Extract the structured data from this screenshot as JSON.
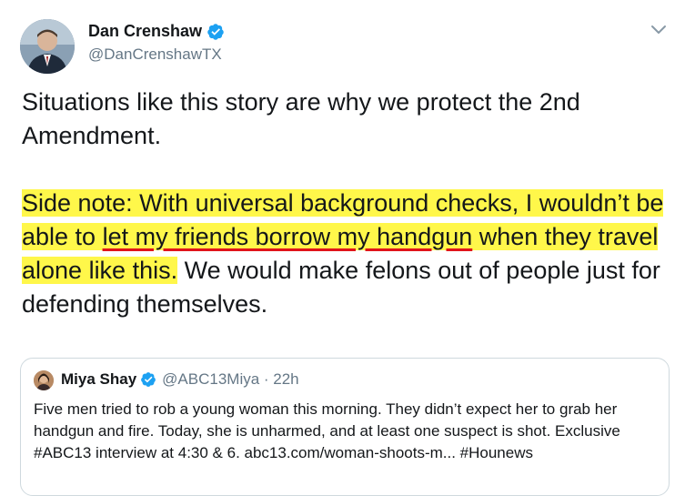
{
  "tweet": {
    "author_name": "Dan Crenshaw",
    "author_handle": "@DanCrenshawTX",
    "paragraph1": "Situations like this story are why we protect the 2nd Amendment.",
    "paragraph2": {
      "hl1": "Side note: With universal background checks, I wouldn’t be able to ",
      "underlined": "let my friends borrow my handgun",
      "hl2": " when they travel alone like this.",
      "plain": " We would make felons out of people just for defending themselves."
    }
  },
  "quoted": {
    "author_name": "Miya Shay",
    "meta": "@ABC13Miya · 22h",
    "text": "Five men tried to rob a young woman this morning. They didn’t expect her to grab her handgun and fire. Today, she is unharmed, and at least one suspect is shot. Exclusive #ABC13 interview at 4:30 & 6. abc13.com/woman-shoots-m... #Hounews"
  },
  "icons": {
    "verified": "verified-badge-icon",
    "menu": "chevron-down-icon"
  },
  "colors": {
    "highlight": "#fff74a",
    "underline": "#e0141b",
    "verified": "#1da1f2",
    "muted": "#657786"
  }
}
